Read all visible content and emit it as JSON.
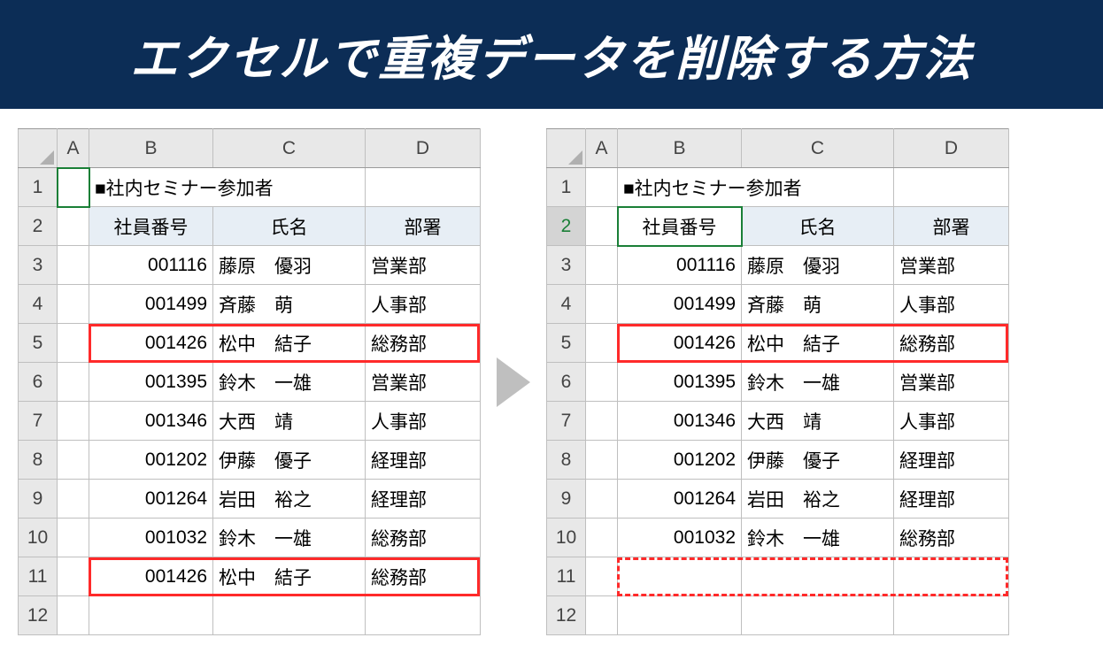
{
  "banner": {
    "title": "エクセルで重複データを削除する方法"
  },
  "common": {
    "cols": {
      "A": "A",
      "B": "B",
      "C": "C",
      "D": "D"
    },
    "rowlabels": [
      "1",
      "2",
      "3",
      "4",
      "5",
      "6",
      "7",
      "8",
      "9",
      "10",
      "11",
      "12"
    ],
    "title_text": "■社内セミナー参加者",
    "headers": {
      "id": "社員番号",
      "name": "氏名",
      "dept": "部署"
    }
  },
  "left": {
    "rows": [
      {
        "id": "001116",
        "name": "藤原　優羽",
        "dept": "営業部"
      },
      {
        "id": "001499",
        "name": "斉藤　萌",
        "dept": "人事部"
      },
      {
        "id": "001426",
        "name": "松中　結子",
        "dept": "総務部"
      },
      {
        "id": "001395",
        "name": "鈴木　一雄",
        "dept": "営業部"
      },
      {
        "id": "001346",
        "name": "大西　靖",
        "dept": "人事部"
      },
      {
        "id": "001202",
        "name": "伊藤　優子",
        "dept": "経理部"
      },
      {
        "id": "001264",
        "name": "岩田　裕之",
        "dept": "経理部"
      },
      {
        "id": "001032",
        "name": "鈴木　一雄",
        "dept": "総務部"
      },
      {
        "id": "001426",
        "name": "松中　結子",
        "dept": "総務部"
      }
    ]
  },
  "right": {
    "rows": [
      {
        "id": "001116",
        "name": "藤原　優羽",
        "dept": "営業部"
      },
      {
        "id": "001499",
        "name": "斉藤　萌",
        "dept": "人事部"
      },
      {
        "id": "001426",
        "name": "松中　結子",
        "dept": "総務部"
      },
      {
        "id": "001395",
        "name": "鈴木　一雄",
        "dept": "営業部"
      },
      {
        "id": "001346",
        "name": "大西　靖",
        "dept": "人事部"
      },
      {
        "id": "001202",
        "name": "伊藤　優子",
        "dept": "経理部"
      },
      {
        "id": "001264",
        "name": "岩田　裕之",
        "dept": "経理部"
      },
      {
        "id": "001032",
        "name": "鈴木　一雄",
        "dept": "総務部"
      }
    ]
  }
}
